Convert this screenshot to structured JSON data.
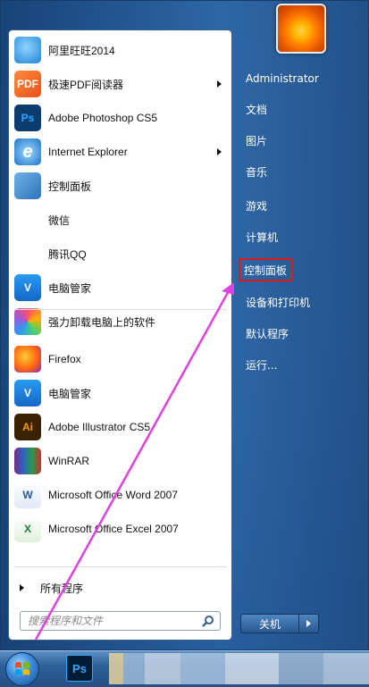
{
  "programs": [
    {
      "label": "阿里旺旺2014",
      "icon": "aliwangwang-icon",
      "has_submenu": false
    },
    {
      "label": "极速PDF阅读器",
      "icon": "pdf-reader-icon",
      "has_submenu": true
    },
    {
      "label": "Adobe Photoshop CS5",
      "icon": "photoshop-icon",
      "has_submenu": false
    },
    {
      "label": "Internet Explorer",
      "icon": "ie-icon",
      "has_submenu": true
    },
    {
      "label": "控制面板",
      "icon": "control-panel-icon",
      "has_submenu": false
    },
    {
      "label": "微信",
      "icon": "wechat-icon",
      "has_submenu": false
    },
    {
      "label": "腾讯QQ",
      "icon": "qq-icon",
      "has_submenu": false
    },
    {
      "label": "电脑管家",
      "icon": "pc-manager-icon",
      "has_submenu": false
    },
    {
      "label": "强力卸载电脑上的软件",
      "icon": "uninstaller-icon",
      "has_submenu": false
    },
    {
      "label": "Firefox",
      "icon": "firefox-icon",
      "has_submenu": false
    },
    {
      "label": "电脑管家",
      "icon": "pc-manager-icon",
      "has_submenu": false
    },
    {
      "label": "Adobe Illustrator CS5",
      "icon": "illustrator-icon",
      "has_submenu": false
    },
    {
      "label": "WinRAR",
      "icon": "winrar-icon",
      "has_submenu": false
    },
    {
      "label": "Microsoft Office Word 2007",
      "icon": "word-icon",
      "has_submenu": false
    },
    {
      "label": "Microsoft Office Excel 2007",
      "icon": "excel-icon",
      "has_submenu": false
    }
  ],
  "all_programs": "所有程序",
  "search": {
    "placeholder": "搜索程序和文件"
  },
  "right": {
    "user": "Administrator",
    "documents": "文档",
    "pictures": "图片",
    "music": "音乐",
    "games": "游戏",
    "computer": "计算机",
    "control_panel": "控制面板",
    "devices_printers": "设备和打印机",
    "default_programs": "默认程序",
    "run": "运行..."
  },
  "shutdown_label": "关机",
  "taskbar": {
    "photoshop": "Ps"
  },
  "colors": {
    "highlight": "#e01818",
    "annotation_arrow": "#e040e0"
  }
}
